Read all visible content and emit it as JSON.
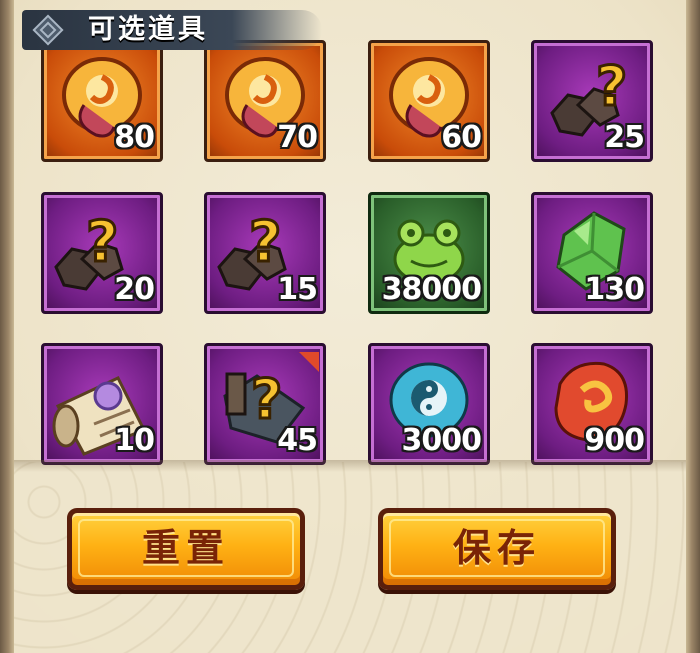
{
  "header": {
    "title": "可选道具",
    "icon": "diamond-emblem-icon"
  },
  "items": [
    {
      "icon": "orange-swirl-coin-icon",
      "rarity": "orange",
      "quantity": "80"
    },
    {
      "icon": "orange-swirl-coin-icon",
      "rarity": "orange",
      "quantity": "70"
    },
    {
      "icon": "orange-swirl-coin-icon",
      "rarity": "orange",
      "quantity": "60"
    },
    {
      "icon": "mystery-ore-icon",
      "rarity": "purple",
      "quantity": "25"
    },
    {
      "icon": "mystery-ore-icon",
      "rarity": "purple",
      "quantity": "20"
    },
    {
      "icon": "mystery-ore-icon",
      "rarity": "purple",
      "quantity": "15"
    },
    {
      "icon": "green-toad-icon",
      "rarity": "green",
      "quantity": "38000"
    },
    {
      "icon": "green-crystal-icon",
      "rarity": "purple",
      "quantity": "130"
    },
    {
      "icon": "scroll-icon",
      "rarity": "purple",
      "quantity": "10"
    },
    {
      "icon": "mystery-bundle-icon",
      "rarity": "purple",
      "quantity": "45"
    },
    {
      "icon": "yin-yang-stone-icon",
      "rarity": "purple",
      "quantity": "3000"
    },
    {
      "icon": "red-swirl-stone-icon",
      "rarity": "purple",
      "quantity": "900"
    }
  ],
  "buttons": {
    "reset_label": "重置",
    "save_label": "保存"
  },
  "colors": {
    "orange_tile": "#d9600f",
    "purple_tile": "#7a2390",
    "green_tile": "#2f6b2f",
    "button_fill": "#ffb114",
    "button_text": "#7a2406",
    "title_bar": "#2f3a48"
  }
}
